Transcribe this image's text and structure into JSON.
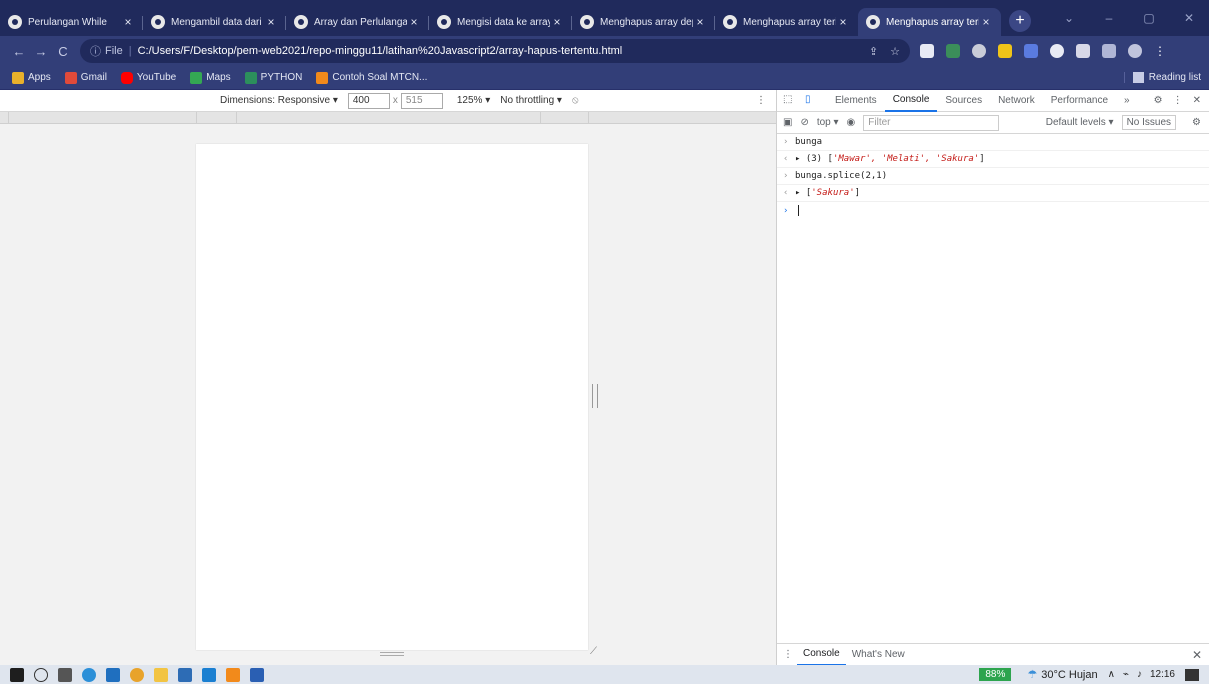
{
  "browser": {
    "tabs": [
      {
        "title": "Perulangan While",
        "active": false
      },
      {
        "title": "Mengambil data dari",
        "active": false
      },
      {
        "title": "Array dan Perlulangan",
        "active": false
      },
      {
        "title": "Mengisi data ke array",
        "active": false
      },
      {
        "title": "Menghapus array dep",
        "active": false
      },
      {
        "title": "Menghapus array teri",
        "active": false
      },
      {
        "title": "Menghapus array teri",
        "active": true
      }
    ],
    "new_tab": "+",
    "url_prefix": "File",
    "url": "C:/Users/F/Desktop/pem-web2021/repo-minggu11/latihan%20Javascript2/array-hapus-tertentu.html"
  },
  "bookmarks": {
    "items": [
      "Apps",
      "Gmail",
      "YouTube",
      "Maps",
      "PYTHON",
      "Contoh Soal MTCN..."
    ],
    "reading_list": "Reading list"
  },
  "device_toolbar": {
    "dimensions_label": "Dimensions: Responsive ▾",
    "width": "400",
    "height": "515",
    "times": "x",
    "zoom": "125% ▾",
    "throttling": "No throttling ▾"
  },
  "devtools": {
    "tabs": [
      "Elements",
      "Console",
      "Sources",
      "Network",
      "Performance"
    ],
    "active_tab": "Console",
    "more": "»",
    "context": "top ▾",
    "filter_placeholder": "Filter",
    "levels": "Default levels ▾",
    "issues": "No Issues",
    "console_lines": [
      {
        "type": "input",
        "text": "bunga"
      },
      {
        "type": "output",
        "prefix": "▸ (3) [",
        "values": "'Mawar', 'Melati', 'Sakura'",
        "suffix": "]"
      },
      {
        "type": "input",
        "text": "bunga.splice(2,1)"
      },
      {
        "type": "output",
        "prefix": "▸ [",
        "values": "'Sakura'",
        "suffix": "]"
      }
    ],
    "drawer_tabs": [
      "Console",
      "What's New"
    ]
  },
  "taskbar": {
    "battery": "88%",
    "weather": "30°C Hujan",
    "time": "12:16"
  }
}
